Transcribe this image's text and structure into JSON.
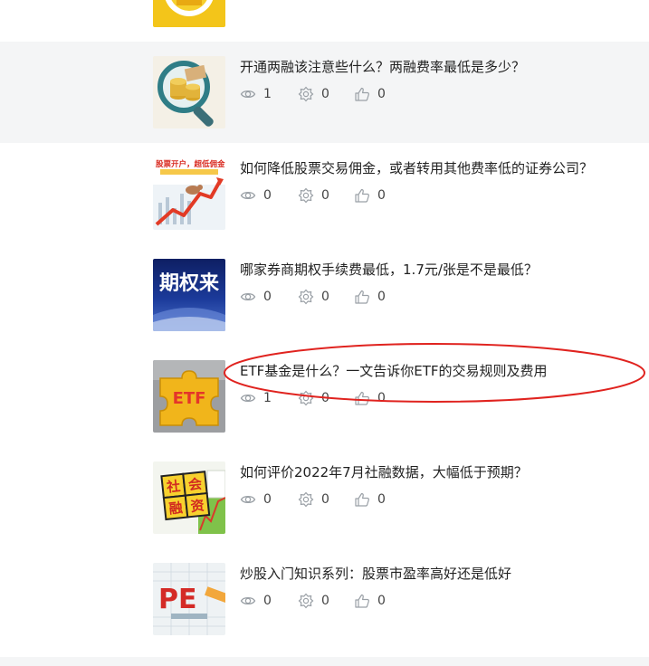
{
  "articles": [
    {
      "title": "开通两融该注意些什么？两融费率最低是多少？",
      "views": "1",
      "shares": "0",
      "likes": "0",
      "thumb_icon": "coins-magnifier-image"
    },
    {
      "title": "如何降低股票交易佣金，或者转用其他费率低的证券公司？",
      "views": "0",
      "shares": "0",
      "likes": "0",
      "thumb_icon": "stock-chart-arrow-image",
      "thumb_text": "股票开户，超低佣金"
    },
    {
      "title": "哪家券商期权手续费最低，1.7元/张是不是最低？",
      "views": "0",
      "shares": "0",
      "likes": "0",
      "thumb_icon": "options-banner-image",
      "thumb_text": "期权来"
    },
    {
      "title": "ETF基金是什么？一文告诉你ETF的交易规则及费用",
      "views": "1",
      "shares": "0",
      "likes": "0",
      "thumb_icon": "etf-puzzle-image",
      "thumb_text": "ETF"
    },
    {
      "title": "如何评价2022年7月社融数据，大幅低于预期？",
      "views": "0",
      "shares": "0",
      "likes": "0",
      "thumb_icon": "social-finance-blocks-image",
      "thumb_chars": [
        "社",
        "会",
        "融",
        "资"
      ]
    },
    {
      "title": "炒股入门知识系列：股票市盈率高好还是低好",
      "views": "0",
      "shares": "0",
      "likes": "0",
      "thumb_icon": "pe-ratio-image",
      "thumb_text": "PE"
    }
  ],
  "colors": {
    "shaded_row": "#f4f5f6",
    "annotation": "#e0231f",
    "meta_icon": "#9aa0a6"
  }
}
